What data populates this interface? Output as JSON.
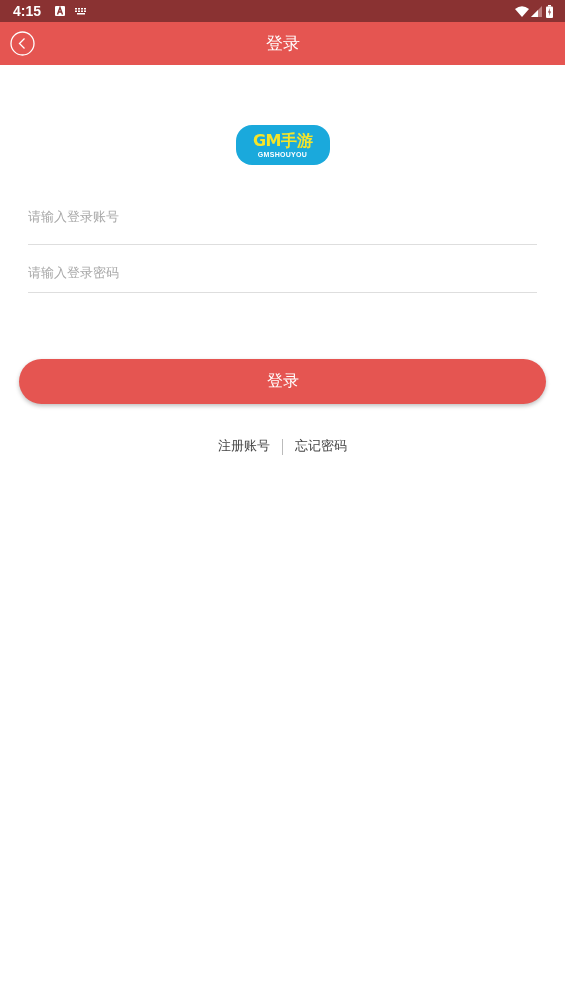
{
  "status_bar": {
    "time": "4:15"
  },
  "header": {
    "title": "登录"
  },
  "logo": {
    "title": "GM手游",
    "subtitle": "GMSHOUYOU"
  },
  "fields": [
    {
      "placeholder": "请输入登录账号"
    },
    {
      "placeholder": "请输入登录密码"
    }
  ],
  "login_button": "登录",
  "links": [
    "注册账号",
    "忘记密码"
  ]
}
